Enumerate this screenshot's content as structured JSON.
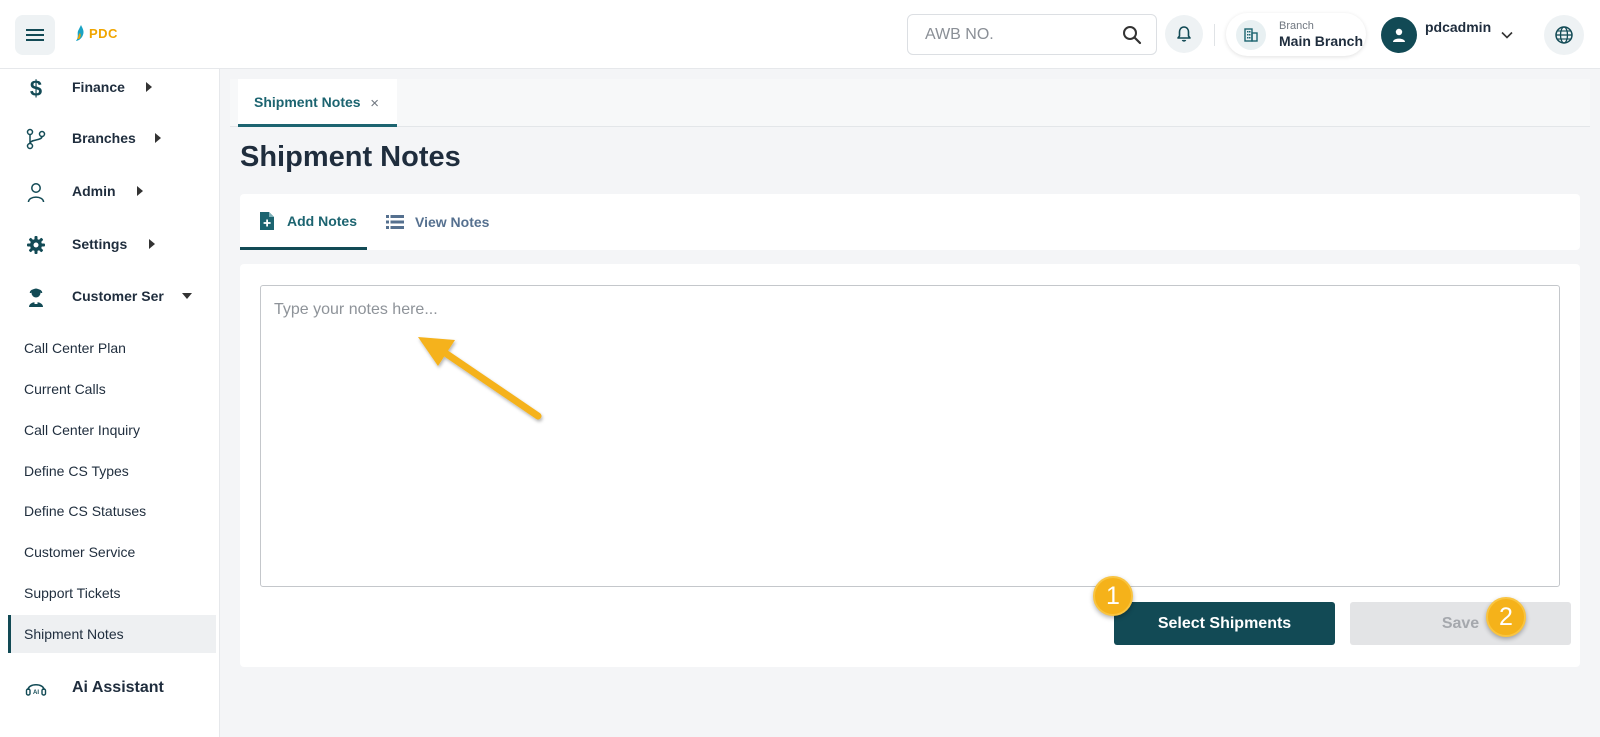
{
  "header": {
    "logo_text": "PDC",
    "search": {
      "placeholder": "AWB NO.",
      "value": ""
    },
    "branch": {
      "caption": "Branch",
      "name": "Main Branch"
    },
    "user": {
      "name": "pdcadmin"
    }
  },
  "sidebar": {
    "items": [
      {
        "label": "Finance",
        "icon": "dollar-icon"
      },
      {
        "label": "Branches",
        "icon": "branch-icon"
      },
      {
        "label": "Admin",
        "icon": "user-icon"
      },
      {
        "label": "Settings",
        "icon": "gear-icon"
      },
      {
        "label": "Customer Ser",
        "icon": "agent-icon"
      }
    ],
    "sub_items": [
      {
        "label": "Call Center Plan"
      },
      {
        "label": "Current Calls"
      },
      {
        "label": "Call Center Inquiry"
      },
      {
        "label": "Define CS Types"
      },
      {
        "label": "Define CS Statuses"
      },
      {
        "label": "Customer Service"
      },
      {
        "label": "Support Tickets"
      },
      {
        "label": "Shipment Notes"
      }
    ],
    "ai_assistant": {
      "label": "Ai Assistant",
      "icon": "ai-headset-icon"
    }
  },
  "main": {
    "open_tab": {
      "label": "Shipment Notes",
      "close": "×"
    },
    "page_title": "Shipment Notes",
    "subtabs": [
      {
        "label": "Add Notes",
        "icon": "add-document-icon"
      },
      {
        "label": "View Notes",
        "icon": "list-icon"
      }
    ],
    "notes": {
      "placeholder": "Type your notes here...",
      "value": ""
    },
    "buttons": {
      "select_shipments": "Select Shipments",
      "save": "Save"
    }
  },
  "annotations": {
    "badge_1": "1",
    "badge_2": "2"
  },
  "colors": {
    "primary": "#124a55",
    "accent": "#1c6470",
    "highlight": "#f5b21a",
    "logo": "#f0a500"
  }
}
